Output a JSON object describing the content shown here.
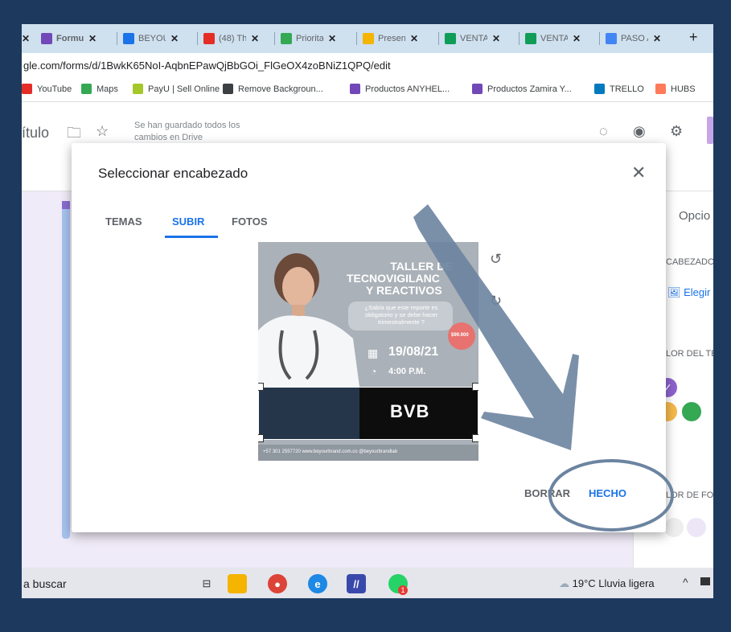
{
  "tabs": [
    {
      "label": "Formu",
      "icon": "forms-icon",
      "color": "#7248b9",
      "active": true
    },
    {
      "label": "BEYOU",
      "icon": "calendar-icon",
      "color": "#1a73e8",
      "active": false
    },
    {
      "label": "(48) Th",
      "icon": "youtube-icon",
      "color": "#e52d27",
      "active": false
    },
    {
      "label": "Priorita",
      "icon": "drive-icon",
      "color": "#34a853",
      "active": false
    },
    {
      "label": "Presen",
      "icon": "slides-icon",
      "color": "#f4b400",
      "active": false
    },
    {
      "label": "VENTA",
      "icon": "sheets-icon",
      "color": "#0f9d58",
      "active": false
    },
    {
      "label": "VENTA",
      "icon": "sheets-icon",
      "color": "#0f9d58",
      "active": false
    },
    {
      "label": "PASO A",
      "icon": "google-icon",
      "color": "#4285f4",
      "active": false
    }
  ],
  "tab_close": "✕",
  "new_tab": "+",
  "url": "gle.com/forms/d/1BwkK65NoI-AqbnEPawQjBbGOi_FlGeOX4zoBNiZ1QPQ/edit",
  "bookmarks": [
    {
      "label": "YouTube",
      "color": "#e52d27"
    },
    {
      "label": "Maps",
      "color": "#34a853"
    },
    {
      "label": "PayU | Sell Online",
      "color": "#a6c729"
    },
    {
      "label": "Remove Backgroun...",
      "color": "#3c4043"
    },
    {
      "label": "Productos ANYHEL...",
      "color": "#7248b9"
    },
    {
      "label": "Productos Zamira Y...",
      "color": "#7248b9"
    },
    {
      "label": "TRELLO",
      "color": "#0079bf"
    },
    {
      "label": "HUBS",
      "color": "#ff7a59"
    }
  ],
  "form_header": {
    "title": "ítulo",
    "saved": "Se han guardado todos los cambios en Drive"
  },
  "right_panel": {
    "options": "Opcio",
    "header_label": "CABEZADO",
    "choose": "Elegir",
    "theme_color": "LOR DEL TE",
    "bg_color": "LOR DE FO",
    "swatch_colors": [
      "#db4437",
      "#8e63ce",
      "#e8804a",
      "#f6b94a",
      "#34a853"
    ]
  },
  "dialog": {
    "title": "Seleccionar encabezado",
    "close": "✕",
    "tabs": [
      "TEMAS",
      "SUBIR",
      "FOTOS"
    ],
    "active_tab": "SUBIR",
    "delete_label": "BORRAR",
    "done_label": "HECHO"
  },
  "poster": {
    "headline1": "TALLER DE",
    "headline2": "TECNOVIGILANC",
    "headline3": "Y REACTIVOS",
    "question": "¿Sabía que este reporte es obligatorio y se debe hacer trimestralmente ?",
    "price": "$99.900",
    "date": "19/08/21",
    "time": "4:00 P.M.",
    "brand": "BVB",
    "footer": "+57 301 2557720   www.beyourbrand.com.co   @beyourbrandlab"
  },
  "taskbar": {
    "search": "a buscar",
    "weather": "19°C  Lluvia ligera",
    "badge": "1"
  },
  "annotation": {
    "arrow_color": "#6b84a0",
    "circle_color": "#6b84a0"
  }
}
